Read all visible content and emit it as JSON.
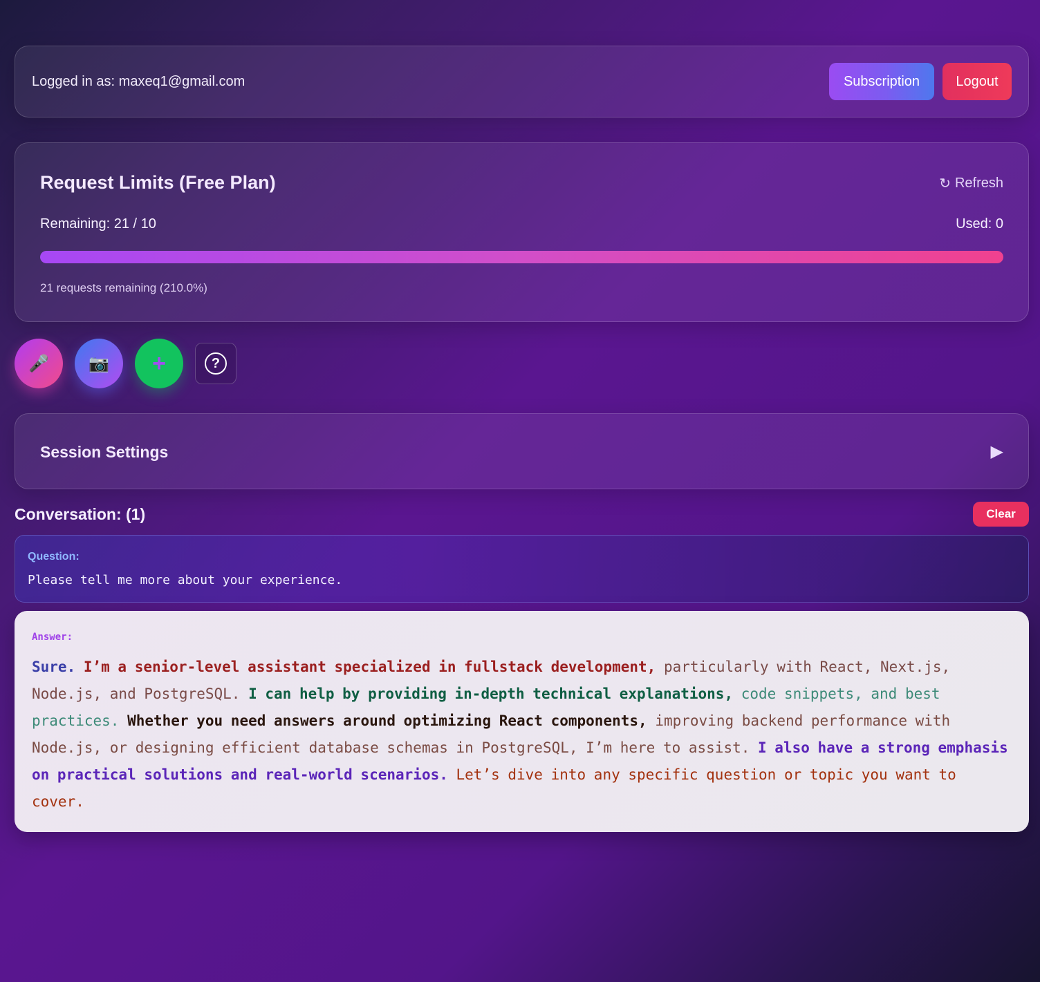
{
  "header": {
    "login_text": "Logged in as: maxeq1@gmail.com",
    "subscription_label": "Subscription",
    "logout_label": "Logout"
  },
  "limits": {
    "title": "Request Limits (Free Plan)",
    "refresh_label": "Refresh",
    "refresh_icon": "↻",
    "remaining_text": "Remaining: 21 / 10",
    "used_text": "Used: 0",
    "progress_fraction": 1.0,
    "percent_text": "21 requests remaining (210.0%)"
  },
  "actions": {
    "mic_icon": "🎤",
    "camera_icon": "📷",
    "add_icon": "+",
    "help_icon": "?"
  },
  "settings": {
    "title": "Session Settings",
    "arrow_icon": "▶"
  },
  "conversation": {
    "title": "Conversation: (1)",
    "clear_label": "Clear",
    "question_label": "Question:",
    "question_text": "Please tell me more about your experience.",
    "answer_label": "Answer:",
    "answer_segments": [
      "Sure.",
      " I’m a senior-level assistant specialized in fullstack development,",
      " particularly with React, Next.js, Node.js, and PostgreSQL.",
      " I can help by providing in-depth technical explanations,",
      " code snippets, and best practices.",
      " Whether you need answers around optimizing React components,",
      " improving backend performance with Node.js, or designing efficient database schemas in PostgreSQL, I’m here to assist.",
      " I also have a strong emphasis on practical solutions and real-world scenarios.",
      " Let’s dive into any specific question or topic you want to cover."
    ]
  },
  "colors": {
    "subscription_gradient": [
      "#9a4cf2",
      "#4e78ee"
    ],
    "logout": "#e2305e",
    "clear": "#e8305f",
    "progress_gradient": [
      "#a648f5",
      "#f0418f"
    ],
    "add_button": "#12c35e"
  }
}
